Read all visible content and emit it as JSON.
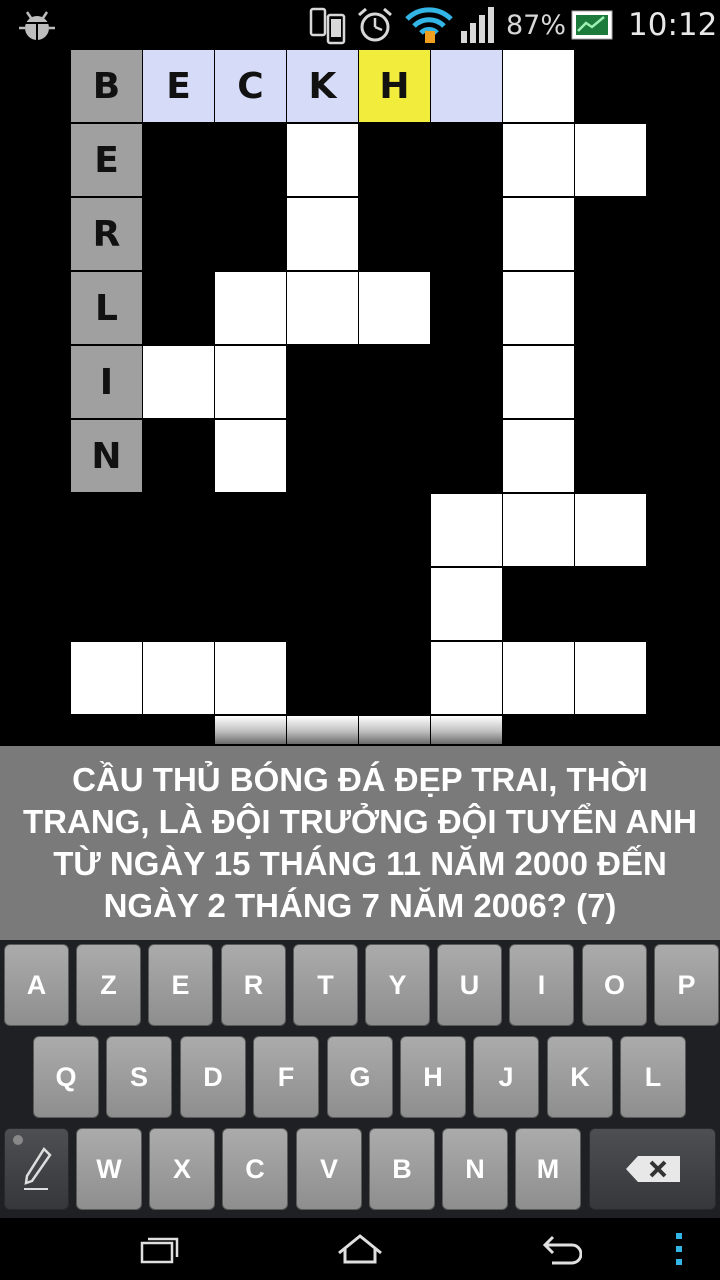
{
  "status_bar": {
    "battery_percent": "87%",
    "time": "10:12"
  },
  "grid": {
    "rows": [
      [
        ".",
        "B",
        "E",
        "C",
        "K",
        "H",
        "",
        "",
        "."
      ],
      [
        ".",
        "E",
        ".",
        ".",
        "",
        ".",
        ".",
        "",
        ""
      ],
      [
        ".",
        "R",
        ".",
        ".",
        "",
        ".",
        ".",
        "",
        "."
      ],
      [
        ".",
        "L",
        ".",
        "",
        "",
        "",
        ".",
        "",
        "."
      ],
      [
        ".",
        "I",
        "",
        "",
        ".",
        ".",
        ".",
        "",
        "."
      ],
      [
        ".",
        "N",
        ".",
        "",
        ".",
        ".",
        ".",
        "",
        "."
      ],
      [
        ".",
        ".",
        ".",
        ".",
        ".",
        ".",
        "",
        "",
        ""
      ],
      [
        ".",
        ".",
        ".",
        ".",
        ".",
        ".",
        "",
        ".",
        "."
      ],
      [
        ".",
        "",
        "",
        "",
        ".",
        ".",
        "",
        "",
        ""
      ],
      [
        ".",
        ".",
        ".",
        "",
        "",
        "",
        "",
        ".",
        "."
      ]
    ],
    "answer_word_1": "BERLIN",
    "current_entry": "BECKH",
    "cell_colors": {
      "white": "#ffffff",
      "solved": "#a0a0a0",
      "active_word": "#d6dcf7",
      "cursor": "#f2ec3c"
    }
  },
  "clue": {
    "text": "CẦU THỦ BÓNG ĐÁ ĐẸP TRAI, THỜI TRANG, LÀ ĐỘI TRƯỞNG ĐỘI TUYỂN ANH TỪ NGÀY 15 THÁNG 11 NĂM 2000 ĐẾN NGÀY 2 THÁNG 7 NĂM 2006? (7)"
  },
  "keyboard": {
    "row1": [
      "A",
      "Z",
      "E",
      "R",
      "T",
      "Y",
      "U",
      "I",
      "O",
      "P"
    ],
    "row2": [
      "Q",
      "S",
      "D",
      "F",
      "G",
      "H",
      "J",
      "K",
      "L"
    ],
    "row3": [
      "W",
      "X",
      "C",
      "V",
      "B",
      "N",
      "M"
    ],
    "pen_icon": "pencil-icon",
    "backspace_icon": "backspace-icon"
  },
  "nav_bar": {
    "recent_icon": "recent-apps-icon",
    "home_icon": "home-icon",
    "back_icon": "back-icon",
    "menu_icon": "overflow-menu-icon",
    "menu_color": "#33b5e5"
  }
}
